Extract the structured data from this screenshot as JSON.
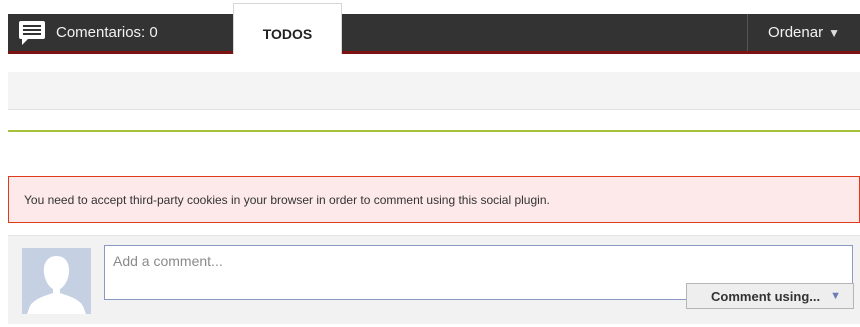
{
  "header": {
    "comments_label": "Comentarios: 0",
    "active_tab": "TODOS",
    "sort_label": "Ordenar",
    "sort_arrow": "▼"
  },
  "notice": {
    "cookie_message": "You need to accept third-party cookies in your browser in order to comment using this social plugin."
  },
  "composer": {
    "placeholder": "Add a comment...",
    "value": "",
    "submit_label": "Comment using...",
    "submit_arrow": "▼"
  },
  "colors": {
    "header_bg": "#333333",
    "header_accent": "#7c1212",
    "divider_green": "#a7c23c",
    "warning_border": "#dd3b1c",
    "warning_bg": "#fde9e9",
    "avatar_bg": "#c5d0e2"
  },
  "icons": {
    "comments": "speech-bubble-icon",
    "avatar": "default-avatar-silhouette-icon",
    "dropdown": "triangle-down-icon"
  }
}
